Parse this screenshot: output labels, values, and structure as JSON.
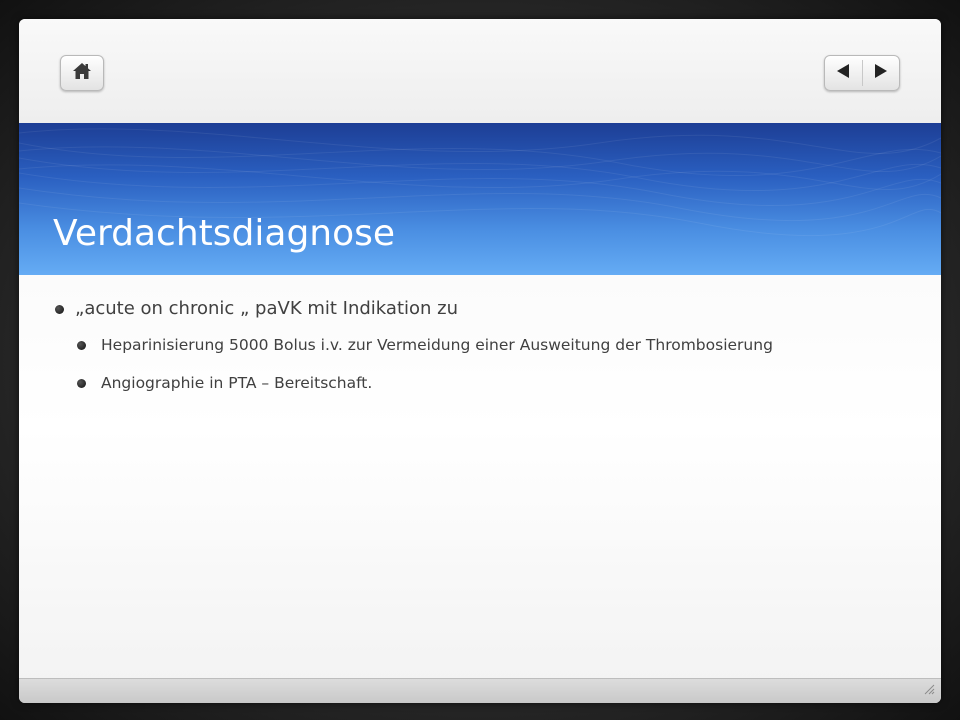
{
  "toolbar": {
    "home_icon": "home-icon",
    "prev_icon": "triangle-left-icon",
    "next_icon": "triangle-right-icon"
  },
  "slide": {
    "title": "Verdachtsdiagnose",
    "bullets": [
      {
        "text": "„acute on chronic „ paVK mit Indikation zu",
        "children": [
          "Heparinisierung 5000 Bolus i.v. zur Vermeidung einer Ausweitung der Thrombosierung",
          "Angiographie in PTA – Bereitschaft."
        ]
      }
    ]
  },
  "colors": {
    "title_band_dark": "#1d3e95",
    "title_band_light": "#65acf4",
    "body_text": "#404040"
  }
}
